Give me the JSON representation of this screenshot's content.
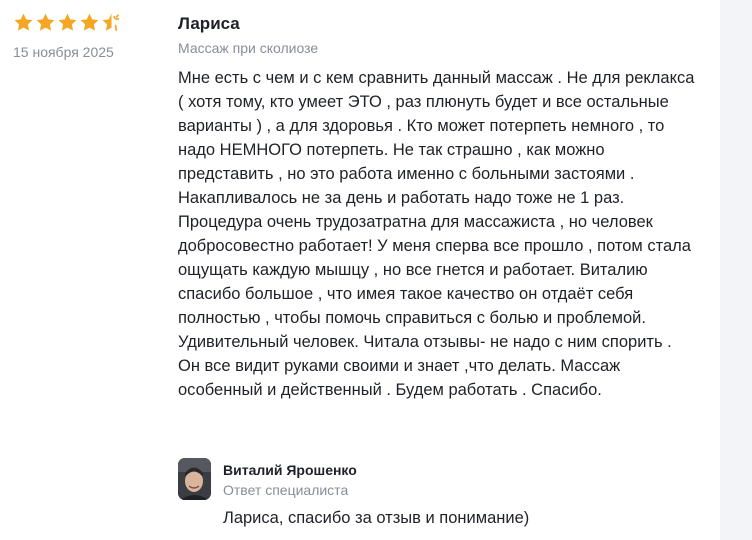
{
  "review": {
    "rating": 4.5,
    "rating_max": 5,
    "date": "15 ноября 2025",
    "author": "Лариса",
    "service": "Массаж при сколиозе",
    "text": "Мне есть с чем и с кем сравнить данный массаж . Не для реклакса ( хотя тому, кто умеет ЭТО , раз плюнуть будет и все остальные варианты ) , а для здоровья . Кто может потерпеть немного , то надо НЕМНОГО потерпеть. Не так страшно , как можно представить , но это работа именно с больными застоями . Накапливалось не за день и работать надо тоже не 1 раз. Процедура очень трудозатратна для массажиста , но человек добросовестно работает! У меня сперва все прошло , потом стала ощущать каждую мышцу , но все гнется и работает. Виталию спасибо большое , что имея такое качество он отдаёт себя полностью , чтобы помочь справиться с болью и проблемой. Удивительный человек. Читала отзывы- не надо с ним спорить . Он все видит руками своими и знает ,что делать. Массаж особенный и действенный . Будем работать . Спасибо."
  },
  "reply": {
    "name": "Виталий Ярошенко",
    "role": "Ответ специалиста",
    "text": "Лариса, спасибо за отзыв и понимание)"
  },
  "colors": {
    "star": "#f5a623",
    "muted_text": "#8a8d99",
    "main_text": "#1f2128",
    "gutter": "#f3f4f8"
  },
  "icons": [
    "star-icon",
    "half-star-icon",
    "avatar-photo"
  ]
}
